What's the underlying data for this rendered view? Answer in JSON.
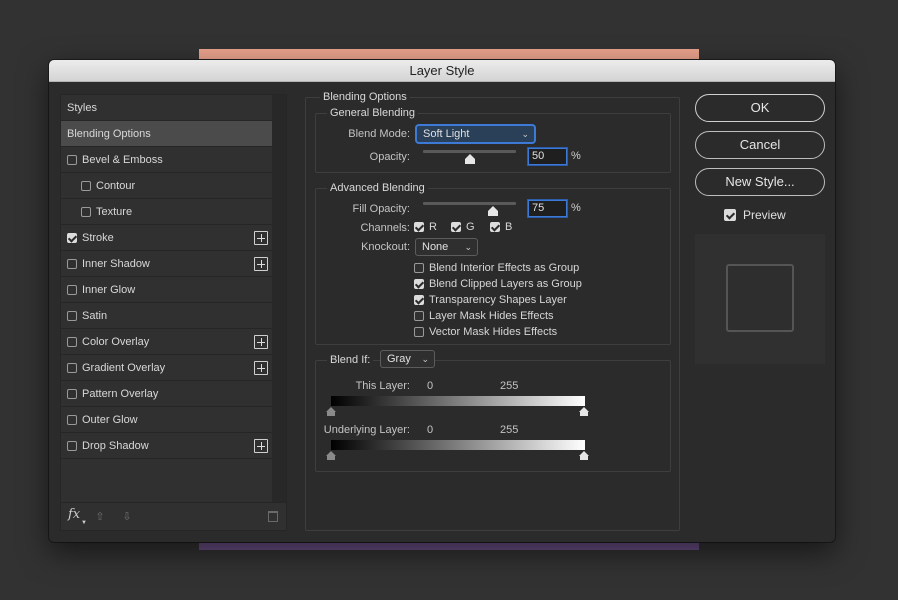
{
  "dialog": {
    "title": "Layer Style"
  },
  "styles_panel": {
    "items": [
      {
        "label": "Styles",
        "checkbox": false,
        "checked": false,
        "indent": false,
        "plus": false,
        "selected": false
      },
      {
        "label": "Blending Options",
        "checkbox": false,
        "checked": false,
        "indent": false,
        "plus": false,
        "selected": true
      },
      {
        "label": "Bevel & Emboss",
        "checkbox": true,
        "checked": false,
        "indent": false,
        "plus": false,
        "selected": false
      },
      {
        "label": "Contour",
        "checkbox": true,
        "checked": false,
        "indent": true,
        "plus": false,
        "selected": false
      },
      {
        "label": "Texture",
        "checkbox": true,
        "checked": false,
        "indent": true,
        "plus": false,
        "selected": false
      },
      {
        "label": "Stroke",
        "checkbox": true,
        "checked": true,
        "indent": false,
        "plus": true,
        "selected": false
      },
      {
        "label": "Inner Shadow",
        "checkbox": true,
        "checked": false,
        "indent": false,
        "plus": true,
        "selected": false
      },
      {
        "label": "Inner Glow",
        "checkbox": true,
        "checked": false,
        "indent": false,
        "plus": false,
        "selected": false
      },
      {
        "label": "Satin",
        "checkbox": true,
        "checked": false,
        "indent": false,
        "plus": false,
        "selected": false
      },
      {
        "label": "Color Overlay",
        "checkbox": true,
        "checked": false,
        "indent": false,
        "plus": true,
        "selected": false
      },
      {
        "label": "Gradient Overlay",
        "checkbox": true,
        "checked": false,
        "indent": false,
        "plus": true,
        "selected": false
      },
      {
        "label": "Pattern Overlay",
        "checkbox": true,
        "checked": false,
        "indent": false,
        "plus": false,
        "selected": false
      },
      {
        "label": "Outer Glow",
        "checkbox": true,
        "checked": false,
        "indent": false,
        "plus": false,
        "selected": false
      },
      {
        "label": "Drop Shadow",
        "checkbox": true,
        "checked": false,
        "indent": false,
        "plus": true,
        "selected": false
      }
    ],
    "footer": {
      "fx_label": "fx"
    }
  },
  "blending_options": {
    "title": "Blending Options",
    "general": {
      "title": "General Blending",
      "blend_mode_label": "Blend Mode:",
      "blend_mode_value": "Soft Light",
      "opacity_label": "Opacity:",
      "opacity_value": "50",
      "opacity_unit": "%"
    },
    "advanced": {
      "title": "Advanced Blending",
      "fill_opacity_label": "Fill Opacity:",
      "fill_opacity_value": "75",
      "fill_opacity_unit": "%",
      "channels_label": "Channels:",
      "channels": [
        {
          "label": "R",
          "checked": true
        },
        {
          "label": "G",
          "checked": true
        },
        {
          "label": "B",
          "checked": true
        }
      ],
      "knockout_label": "Knockout:",
      "knockout_value": "None",
      "options": [
        {
          "label": "Blend Interior Effects as Group",
          "checked": false
        },
        {
          "label": "Blend Clipped Layers as Group",
          "checked": true
        },
        {
          "label": "Transparency Shapes Layer",
          "checked": true
        },
        {
          "label": "Layer Mask Hides Effects",
          "checked": false
        },
        {
          "label": "Vector Mask Hides Effects",
          "checked": false
        }
      ]
    },
    "blend_if": {
      "label": "Blend If:",
      "value": "Gray",
      "this_layer_label": "This Layer:",
      "this_layer_min": "0",
      "this_layer_max": "255",
      "underlying_label": "Underlying Layer:",
      "underlying_min": "0",
      "underlying_max": "255"
    }
  },
  "buttons": {
    "ok": "OK",
    "cancel": "Cancel",
    "new_style": "New Style...",
    "preview_label": "Preview",
    "preview_checked": true
  },
  "colors": {
    "canvas_top": "#e9a28c",
    "canvas_bottom": "#6a4f86",
    "focus_accent": "#3d7ad6"
  }
}
